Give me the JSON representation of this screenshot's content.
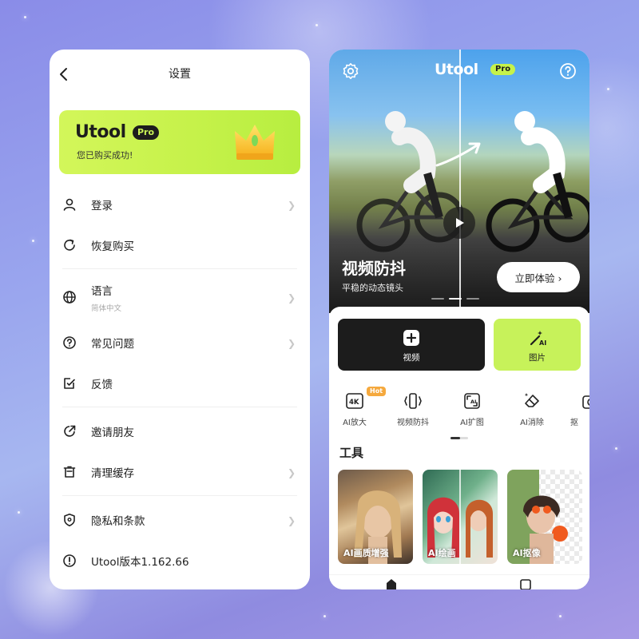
{
  "left": {
    "title": "设置",
    "pro_card": {
      "brand": "Utool",
      "badge": "Pro",
      "status": "您已购买成功!"
    },
    "menu": [
      {
        "label": "登录",
        "sub": "",
        "icon": "user-icon"
      },
      {
        "label": "恢复购买",
        "sub": "",
        "icon": "refresh-icon"
      },
      {
        "label": "语言",
        "sub": "简体中文",
        "icon": "globe-icon"
      },
      {
        "label": "常见问题",
        "sub": "",
        "icon": "help-icon"
      },
      {
        "label": "反馈",
        "sub": "",
        "icon": "feedback-icon"
      },
      {
        "label": "邀请朋友",
        "sub": "",
        "icon": "share-icon"
      },
      {
        "label": "清理缓存",
        "sub": "",
        "icon": "trash-icon"
      },
      {
        "label": "隐私和条款",
        "sub": "",
        "icon": "shield-icon"
      },
      {
        "label": "Utool版本1.162.66",
        "sub": "",
        "icon": "info-icon"
      }
    ]
  },
  "right": {
    "brand": "Utool",
    "badge": "Pro",
    "hero": {
      "title": "视频防抖",
      "subtitle": "平稳的动态镜头",
      "cta": "立即体验 ›"
    },
    "main_buttons": [
      {
        "label": "视频",
        "icon": "plus-icon"
      },
      {
        "label": "图片",
        "icon": "magic-wand-ai-icon"
      }
    ],
    "tools": [
      {
        "label": "AI放大",
        "badge": "Hot",
        "icon": "upscale-4k-icon"
      },
      {
        "label": "视频防抖",
        "badge": "",
        "icon": "stabilize-icon"
      },
      {
        "label": "AI扩图",
        "badge": "",
        "icon": "expand-ai-icon"
      },
      {
        "label": "AI消除",
        "badge": "",
        "icon": "eraser-icon"
      },
      {
        "label": "抠",
        "badge": "",
        "icon": "camera-icon"
      }
    ],
    "section_title": "工具",
    "cards": [
      {
        "label": "AI画质增强"
      },
      {
        "label": "AI绘画"
      },
      {
        "label": "AI抠像"
      }
    ]
  },
  "colors": {
    "accent_green": "#c7f25a",
    "dark": "#1c1c1c",
    "hot_badge": "#f5a93e"
  }
}
